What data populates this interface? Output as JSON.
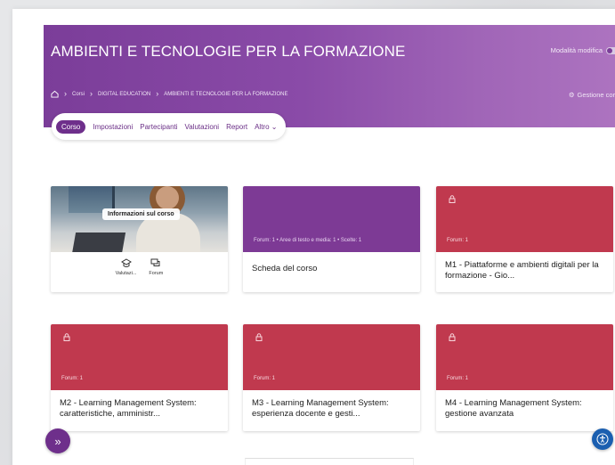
{
  "header": {
    "course_title": "AMBIENTI E TECNOLOGIE PER LA FORMAZIONE",
    "edit_mode_label": "Modalità modifica",
    "manage_course_label": "Gestione corso",
    "breadcrumb": [
      "Corsi",
      "DIGITAL EDUCATION",
      "AMBIENTI E TECNOLOGIE PER LA FORMAZIONE"
    ]
  },
  "tabs": [
    {
      "label": "Corso",
      "active": true
    },
    {
      "label": "Impostazioni"
    },
    {
      "label": "Partecipanti"
    },
    {
      "label": "Valutazioni"
    },
    {
      "label": "Report"
    },
    {
      "label": "Altro ⌄"
    }
  ],
  "cards": {
    "info": {
      "overlay_label": "Informazioni sul corso",
      "icons": [
        {
          "icon": "graduation-cap-icon",
          "label": "Valutazi..."
        },
        {
          "icon": "forum-icon",
          "label": "Forum"
        }
      ]
    },
    "scheda": {
      "meta": "Forum: 1   •   Aree di testo e media: 1   •   Scelte: 1",
      "title": "Scheda del corso"
    },
    "m1": {
      "meta": "Forum: 1",
      "title": "M1 - Piattaforme e ambienti digitali per la formazione - Gio..."
    },
    "m2": {
      "meta": "Forum: 1",
      "title": "M2 - Learning Management System: caratteristiche, amministr..."
    },
    "m3": {
      "meta": "Forum: 1",
      "title": "M3 - Learning Management System: esperienza docente e gesti..."
    },
    "m4": {
      "meta": "Forum: 1",
      "title": "M4 - Learning Management System: gestione avanzata"
    }
  },
  "colors": {
    "banner": "#7b3d99",
    "tab_active": "#6e2f8b",
    "card_red": "#c0394e",
    "card_purple": "#7d3a95",
    "accessibility": "#1b5fb0"
  }
}
